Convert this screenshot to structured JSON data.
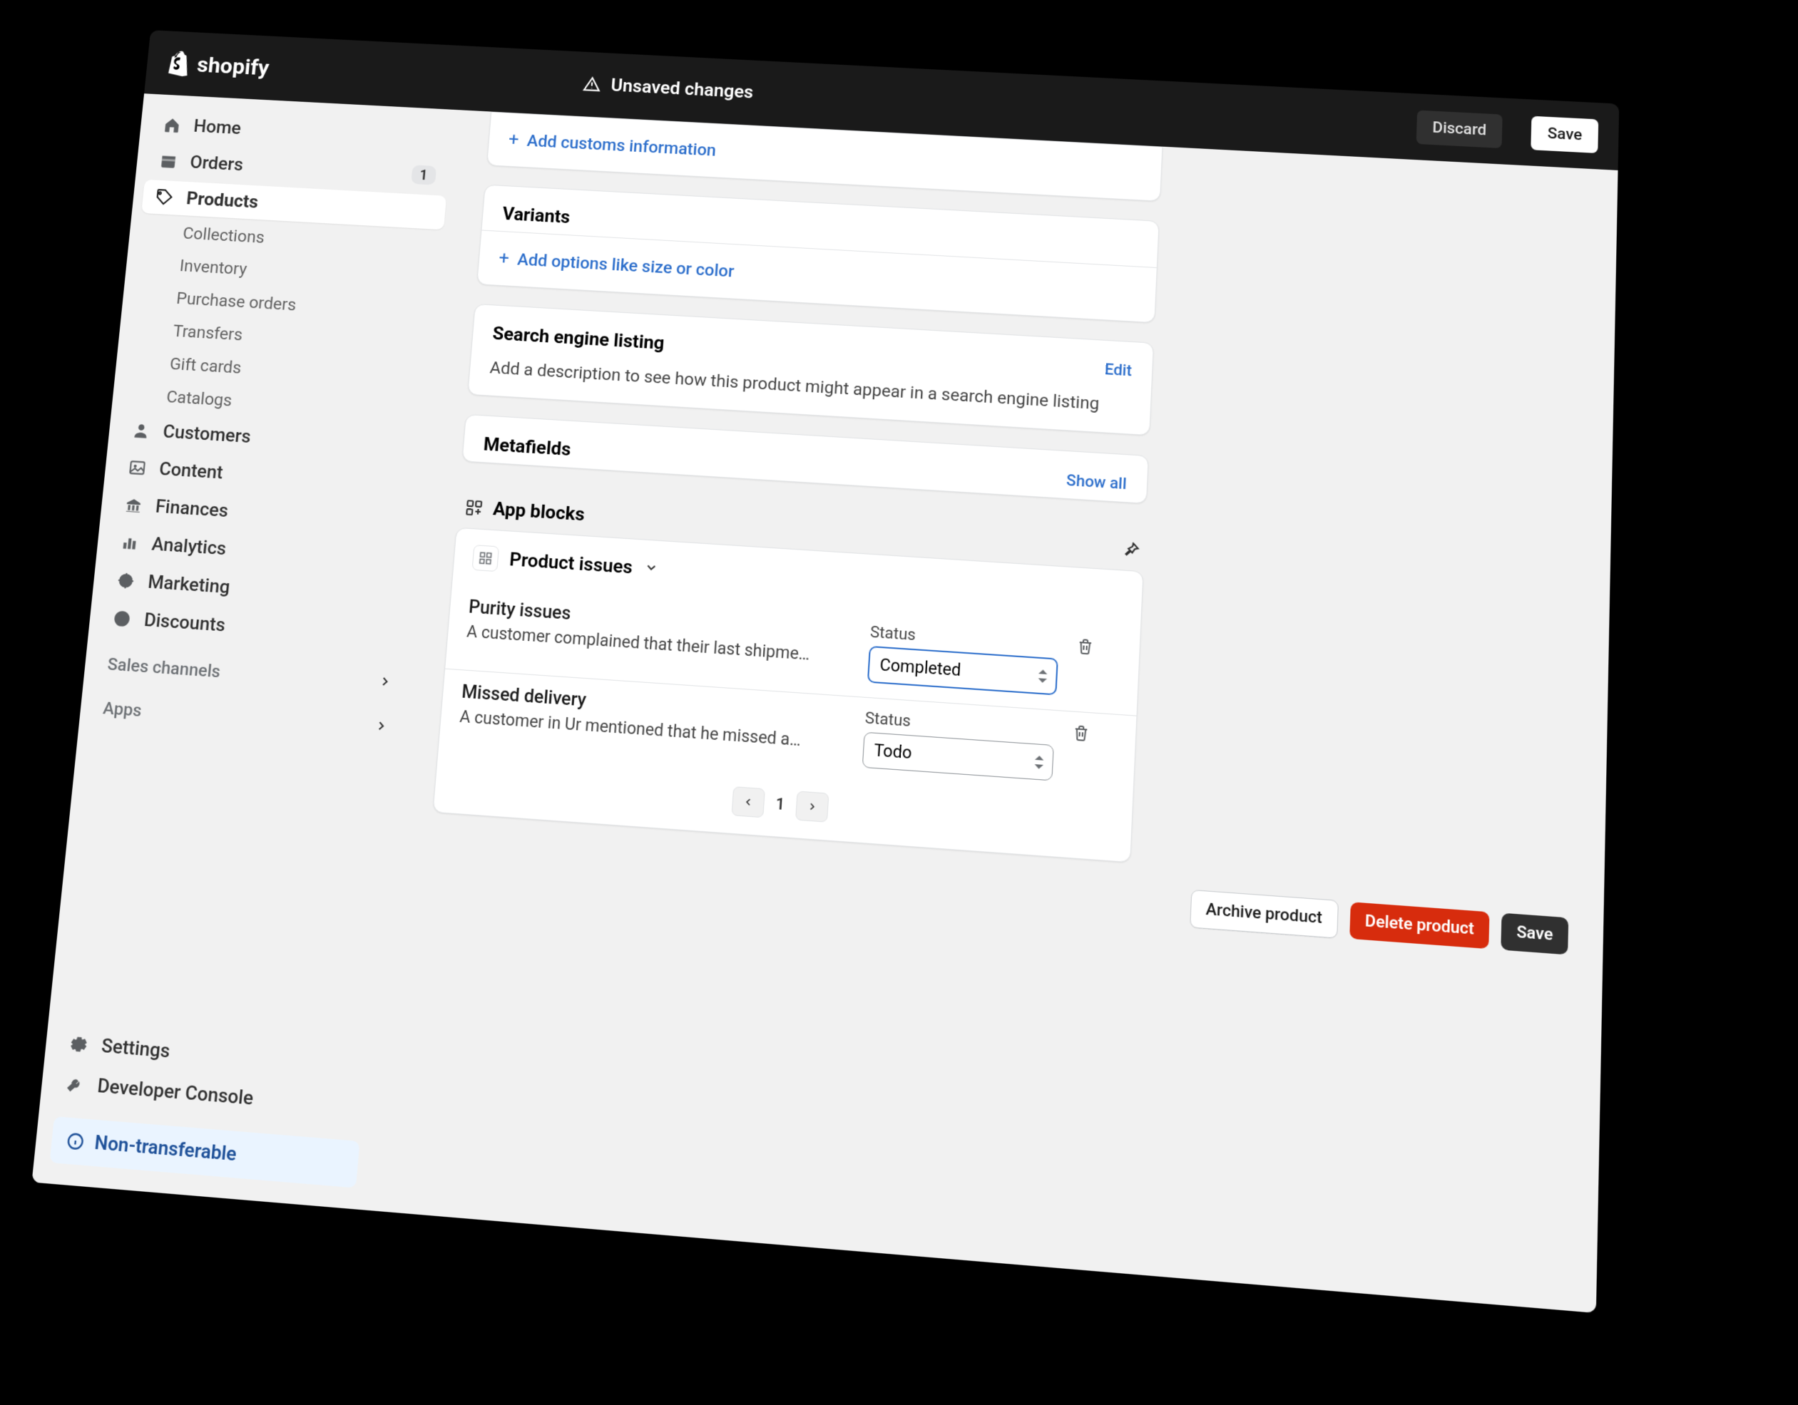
{
  "brand": "shopify",
  "topbar": {
    "unsaved": "Unsaved changes",
    "discard": "Discard",
    "save": "Save"
  },
  "sidebar": {
    "home": "Home",
    "orders": "Orders",
    "orders_badge": "1",
    "products": "Products",
    "products_children": [
      "Collections",
      "Inventory",
      "Purchase orders",
      "Transfers",
      "Gift cards",
      "Catalogs"
    ],
    "customers": "Customers",
    "content": "Content",
    "finances": "Finances",
    "analytics": "Analytics",
    "marketing": "Marketing",
    "discounts": "Discounts",
    "sales_channels": "Sales channels",
    "apps": "Apps",
    "settings": "Settings",
    "dev_console": "Developer Console",
    "non_transferable": "Non-transferable"
  },
  "cards": {
    "customs_link": "Add customs information",
    "variants_title": "Variants",
    "variants_link": "Add options like size or color",
    "seo_title": "Search engine listing",
    "seo_edit": "Edit",
    "seo_desc": "Add a description to see how this product might appear in a search engine listing",
    "metafields_title": "Metafields",
    "metafields_link": "Show all"
  },
  "appblocks": {
    "heading": "App blocks",
    "app_title": "Product issues",
    "status_label": "Status",
    "issues": [
      {
        "title": "Purity issues",
        "desc": "A customer complained that their last shipme…",
        "status": "Completed",
        "focus": true
      },
      {
        "title": "Missed delivery",
        "desc": "A customer in Ur mentioned that he missed a…",
        "status": "Todo",
        "focus": false
      }
    ],
    "page": "1"
  },
  "footer": {
    "archive": "Archive product",
    "delete": "Delete product",
    "save": "Save"
  }
}
